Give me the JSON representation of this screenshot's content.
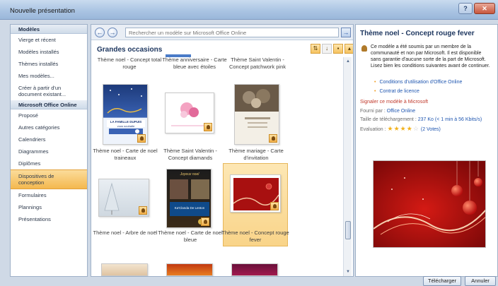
{
  "window": {
    "title": "Nouvelle présentation"
  },
  "sidebar": {
    "section1": "Modèles",
    "items1": [
      "Vierge et récent",
      "Modèles installés",
      "Thèmes installés",
      "Mes modèles...",
      "Créer à partir d'un document existant..."
    ],
    "section2": "Microsoft Office Online",
    "items2": [
      "Proposé",
      "Autres catégories",
      "Calendriers",
      "Diagrammes",
      "Diplômes",
      "Dispositives de conception",
      "Formulaires",
      "Plannings",
      "Présentations"
    ],
    "selected": "Dispositives de conception"
  },
  "search": {
    "placeholder": "Rechercher un modèle sur Microsoft Office Online"
  },
  "gallery": {
    "title": "Grandes occasions",
    "top_labels": [
      "Thème noel - Concept total rouge",
      "Thème anniversaire - Carte bleue avec étoiles",
      "Thème Saint Valentin - Concept patchwork pink"
    ],
    "row1": [
      "Thème noel - Carte de noel traineaux",
      "Thème Saint Valentin - Concept diamands",
      "Thème mariage - Carte d'invitation"
    ],
    "row2": [
      "Thème noel - Arbre de noël",
      "Thème noel - Carte de noel bleue",
      "Thème noel - Concept rouge fever"
    ],
    "card1_text": [
      "LA FAMILLE DUPUIS",
      "vous souhaite"
    ],
    "card2_text": [
      "Joyeux noel",
      "Ka'Clanda De Lenton"
    ],
    "selected": "Thème noel - Concept rouge fever"
  },
  "details": {
    "title": "Thème noel - Concept rouge fever",
    "description": "Ce modèle a été soumis par un membre de la communauté et non par Microsoft. Il est disponible sans garantie d'aucune sorte de la part de Microsoft. Lisez bien les conditions suivantes avant de continuer.",
    "links": [
      "Conditions d'utilisation d'Office Online",
      "Contrat de licence"
    ],
    "report": "Signaler ce modèle à Microsoft",
    "provider_label": "Fourni par :",
    "provider": "Office Online",
    "size_label": "Taille de téléchargement :",
    "size": "237 Ko (< 1 min à 56 Kbits/s)",
    "rating_label": "Evaluation :",
    "rating_stars": 4,
    "votes": "(2 Votes)"
  },
  "buttons": {
    "download": "Télécharger",
    "cancel": "Annuler"
  },
  "colors": {
    "selection": "#f6c35f",
    "accent": "#1c355e",
    "link": "#1f56b0",
    "preview_red": "#a81010"
  }
}
